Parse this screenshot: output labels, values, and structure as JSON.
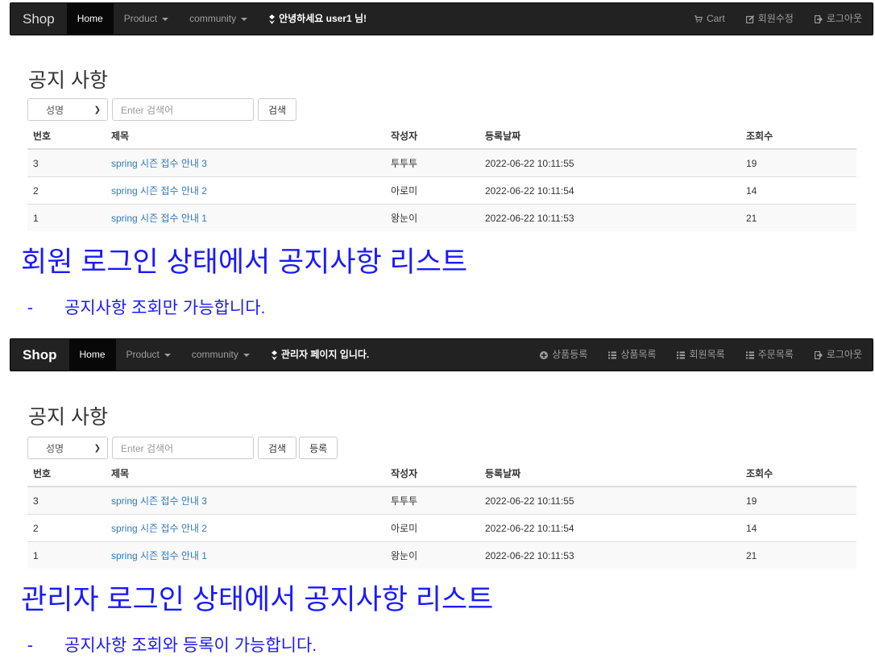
{
  "shot1": {
    "navbar": {
      "brand": "Shop",
      "home": "Home",
      "product": "Product",
      "community": "community",
      "greeting": "안녕하세요 user1 님!",
      "right": [
        {
          "label": "Cart",
          "icon": "cart-icon"
        },
        {
          "label": "회원수정",
          "icon": "edit-icon"
        },
        {
          "label": "로그아웃",
          "icon": "logout-icon"
        }
      ]
    },
    "title": "공지 사항",
    "search": {
      "select": "성명",
      "placeholder": "Enter 검색어",
      "search_btn": "검색"
    },
    "table": {
      "headers": [
        "번호",
        "제목",
        "작성자",
        "등록날짜",
        "조회수"
      ],
      "rows": [
        [
          "3",
          "spring 시즌 접수 안내 3",
          "투투투",
          "2022-06-22 10:11:55",
          "19"
        ],
        [
          "2",
          "spring 시즌 접수 안내 2",
          "아로미",
          "2022-06-22 10:11:54",
          "14"
        ],
        [
          "1",
          "spring 시즌 접수 안내 1",
          "왕눈이",
          "2022-06-22 10:11:53",
          "21"
        ]
      ]
    },
    "caption": "회원 로그인 상태에서 공지사항 리스트",
    "sub": "공지사항 조회만 가능합니다.",
    "sub_dash": "-"
  },
  "shot2": {
    "navbar": {
      "brand": "Shop",
      "home": "Home",
      "product": "Product",
      "community": "community",
      "greeting": "관리자 페이지 입니다.",
      "right": [
        {
          "label": "상품등록",
          "icon": "plus-circle-icon"
        },
        {
          "label": "상품목록",
          "icon": "list-icon"
        },
        {
          "label": "회원목록",
          "icon": "list-icon"
        },
        {
          "label": "주문목록",
          "icon": "list-icon"
        },
        {
          "label": "로그아웃",
          "icon": "logout-icon"
        }
      ]
    },
    "title": "공지 사항",
    "search": {
      "select": "성명",
      "placeholder": "Enter 검색어",
      "search_btn": "검색",
      "register_btn": "등록"
    },
    "table": {
      "headers": [
        "번호",
        "제목",
        "작성자",
        "등록날짜",
        "조회수"
      ],
      "rows": [
        [
          "3",
          "spring 시즌 접수 안내 3",
          "투투투",
          "2022-06-22 10:11:55",
          "19"
        ],
        [
          "2",
          "spring 시즌 접수 안내 2",
          "아로미",
          "2022-06-22 10:11:54",
          "14"
        ],
        [
          "1",
          "spring 시즌 접수 안내 1",
          "왕눈이",
          "2022-06-22 10:11:53",
          "21"
        ]
      ]
    },
    "caption": "관리자 로그인 상태에서 공지사항 리스트",
    "sub": "공지사항 조회와 등록이 가능합니다.",
    "sub_dash": "-"
  },
  "colors": {
    "navbar": "#222222",
    "link": "#337ab7",
    "caption": "#1a1aff"
  }
}
